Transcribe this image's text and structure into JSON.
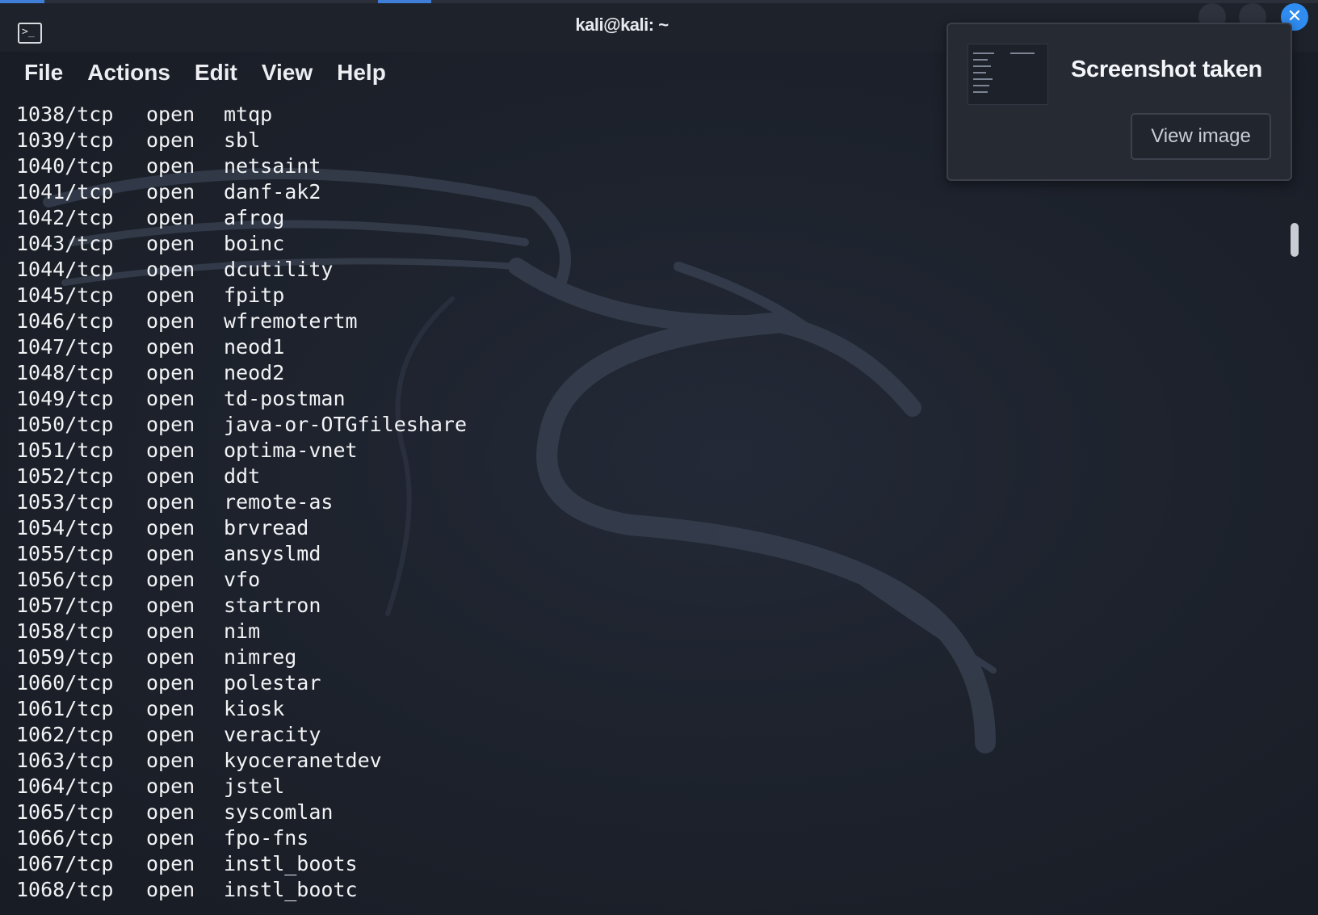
{
  "window": {
    "title": "kali@kali: ~",
    "close_glyph": "✕"
  },
  "menu": {
    "file": "File",
    "actions": "Actions",
    "edit": "Edit",
    "view": "View",
    "help": "Help"
  },
  "icons": {
    "terminal": "terminal-icon",
    "close": "close-icon"
  },
  "colors": {
    "accent": "#2f8cf0",
    "text": "#f2f3f5",
    "background": "#1c212b"
  },
  "output_rows": [
    {
      "port": "1038/tcp",
      "state": "open",
      "service": "mtqp"
    },
    {
      "port": "1039/tcp",
      "state": "open",
      "service": "sbl"
    },
    {
      "port": "1040/tcp",
      "state": "open",
      "service": "netsaint"
    },
    {
      "port": "1041/tcp",
      "state": "open",
      "service": "danf-ak2"
    },
    {
      "port": "1042/tcp",
      "state": "open",
      "service": "afrog"
    },
    {
      "port": "1043/tcp",
      "state": "open",
      "service": "boinc"
    },
    {
      "port": "1044/tcp",
      "state": "open",
      "service": "dcutility"
    },
    {
      "port": "1045/tcp",
      "state": "open",
      "service": "fpitp"
    },
    {
      "port": "1046/tcp",
      "state": "open",
      "service": "wfremotertm"
    },
    {
      "port": "1047/tcp",
      "state": "open",
      "service": "neod1"
    },
    {
      "port": "1048/tcp",
      "state": "open",
      "service": "neod2"
    },
    {
      "port": "1049/tcp",
      "state": "open",
      "service": "td-postman"
    },
    {
      "port": "1050/tcp",
      "state": "open",
      "service": "java-or-OTGfileshare"
    },
    {
      "port": "1051/tcp",
      "state": "open",
      "service": "optima-vnet"
    },
    {
      "port": "1052/tcp",
      "state": "open",
      "service": "ddt"
    },
    {
      "port": "1053/tcp",
      "state": "open",
      "service": "remote-as"
    },
    {
      "port": "1054/tcp",
      "state": "open",
      "service": "brvread"
    },
    {
      "port": "1055/tcp",
      "state": "open",
      "service": "ansyslmd"
    },
    {
      "port": "1056/tcp",
      "state": "open",
      "service": "vfo"
    },
    {
      "port": "1057/tcp",
      "state": "open",
      "service": "startron"
    },
    {
      "port": "1058/tcp",
      "state": "open",
      "service": "nim"
    },
    {
      "port": "1059/tcp",
      "state": "open",
      "service": "nimreg"
    },
    {
      "port": "1060/tcp",
      "state": "open",
      "service": "polestar"
    },
    {
      "port": "1061/tcp",
      "state": "open",
      "service": "kiosk"
    },
    {
      "port": "1062/tcp",
      "state": "open",
      "service": "veracity"
    },
    {
      "port": "1063/tcp",
      "state": "open",
      "service": "kyoceranetdev"
    },
    {
      "port": "1064/tcp",
      "state": "open",
      "service": "jstel"
    },
    {
      "port": "1065/tcp",
      "state": "open",
      "service": "syscomlan"
    },
    {
      "port": "1066/tcp",
      "state": "open",
      "service": "fpo-fns"
    },
    {
      "port": "1067/tcp",
      "state": "open",
      "service": "instl_boots"
    },
    {
      "port": "1068/tcp",
      "state": "open",
      "service": "instl_bootc"
    }
  ],
  "notification": {
    "title": "Screenshot taken",
    "button": "View image"
  }
}
